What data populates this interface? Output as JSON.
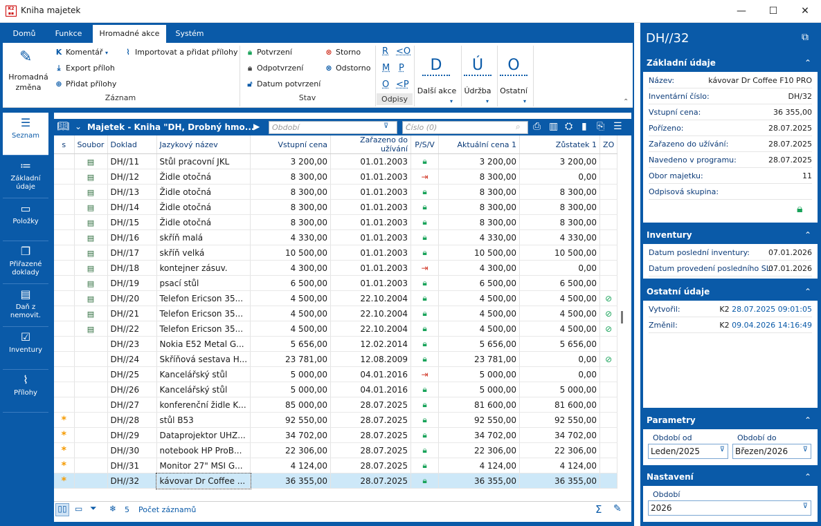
{
  "window": {
    "title": "Kniha majetek",
    "minimize": "—",
    "maximize": "☐",
    "close": "✕"
  },
  "ribbon_tabs": [
    "Domů",
    "Funkce",
    "Hromadné akce",
    "Systém"
  ],
  "ribbon": {
    "hromadna_zmena": "Hromadná změna",
    "komentar": "Komentář",
    "export_priloh": "Export příloh",
    "pridat_prilohy": "Přidat přílohy",
    "importovat": "Importovat a přidat přílohy",
    "group_zaznam": "Záznam",
    "potvrzeni": "Potvrzení",
    "odpotvrzeni": "Odpotvrzení",
    "datum_potvrzeni": "Datum potvrzení",
    "storno": "Storno",
    "odstorno": "Odstorno",
    "group_stav": "Stav",
    "odpis_r": "R",
    "odpis_lo": "<O",
    "odpis_m": "M",
    "odpis_p": "P",
    "odpis_o": "O",
    "odpis_lp": "<P",
    "group_odpisy": "Odpisy",
    "dalsi_letter": "D",
    "dalsi_akce": "Další akce",
    "udrzba_letter": "Ú",
    "udrzba": "Údržba",
    "ostatni_letter": "O",
    "ostatni": "Ostatní"
  },
  "sidebar": [
    {
      "label": "Seznam",
      "icon": "list-lines-icon"
    },
    {
      "label": "Základní údaje",
      "icon": "list-icon"
    },
    {
      "label": "Položky",
      "icon": "box-icon"
    },
    {
      "label": "Přiřazené doklady",
      "icon": "documents-icon"
    },
    {
      "label": "Daň z nemovit.",
      "icon": "calendar-icon"
    },
    {
      "label": "Inventury",
      "icon": "checklist-icon"
    },
    {
      "label": "Přílohy",
      "icon": "paperclip-icon"
    }
  ],
  "grid_toolbar": {
    "title": "Majetek - Kniha \"DH, Drobný hmo...",
    "obdobi_placeholder": "Období",
    "cislo_placeholder": "Číslo (0)"
  },
  "columns": [
    "s",
    "Soubor",
    "Doklad",
    "Jazykový název",
    "Vstupní cena",
    "Zařazeno do užívání",
    "P/S/V",
    "Aktuální cena 1",
    "Zůstatek 1",
    "ZO"
  ],
  "rows": [
    {
      "s": "",
      "file": true,
      "doklad": "DH//11",
      "nazev": "Stůl pracovní JKL",
      "vstup": "3 200,00",
      "zarazeno": "01.01.2003",
      "psv": "lock",
      "akt": "3 200,00",
      "zust": "3 200,00",
      "zo": false
    },
    {
      "s": "",
      "file": true,
      "doklad": "DH//12",
      "nazev": "Židle otočná",
      "vstup": "8 300,00",
      "zarazeno": "01.01.2003",
      "psv": "out",
      "akt": "8 300,00",
      "zust": "0,00",
      "zo": false
    },
    {
      "s": "",
      "file": true,
      "doklad": "DH//13",
      "nazev": "Židle otočná",
      "vstup": "8 300,00",
      "zarazeno": "01.01.2003",
      "psv": "lock",
      "akt": "8 300,00",
      "zust": "8 300,00",
      "zo": false
    },
    {
      "s": "",
      "file": true,
      "doklad": "DH//14",
      "nazev": "Židle otočná",
      "vstup": "8 300,00",
      "zarazeno": "01.01.2003",
      "psv": "lock",
      "akt": "8 300,00",
      "zust": "8 300,00",
      "zo": false
    },
    {
      "s": "",
      "file": true,
      "doklad": "DH//15",
      "nazev": "Židle otočná",
      "vstup": "8 300,00",
      "zarazeno": "01.01.2003",
      "psv": "lock",
      "akt": "8 300,00",
      "zust": "8 300,00",
      "zo": false
    },
    {
      "s": "",
      "file": true,
      "doklad": "DH//16",
      "nazev": "skříň malá",
      "vstup": "4 330,00",
      "zarazeno": "01.01.2003",
      "psv": "lock",
      "akt": "4 330,00",
      "zust": "4 330,00",
      "zo": false
    },
    {
      "s": "",
      "file": true,
      "doklad": "DH//17",
      "nazev": "skříň velká",
      "vstup": "10 500,00",
      "zarazeno": "01.01.2003",
      "psv": "lock",
      "akt": "10 500,00",
      "zust": "10 500,00",
      "zo": false
    },
    {
      "s": "",
      "file": true,
      "doklad": "DH//18",
      "nazev": "kontejner zásuv.",
      "vstup": "4 300,00",
      "zarazeno": "01.01.2003",
      "psv": "out",
      "akt": "4 300,00",
      "zust": "0,00",
      "zo": false
    },
    {
      "s": "",
      "file": true,
      "doklad": "DH//19",
      "nazev": "psací stůl",
      "vstup": "6 500,00",
      "zarazeno": "01.01.2003",
      "psv": "lock",
      "akt": "6 500,00",
      "zust": "6 500,00",
      "zo": false
    },
    {
      "s": "",
      "file": true,
      "doklad": "DH//20",
      "nazev": "Telefon Ericson 35...",
      "vstup": "4 500,00",
      "zarazeno": "22.10.2004",
      "psv": "lock",
      "akt": "4 500,00",
      "zust": "4 500,00",
      "zo": true
    },
    {
      "s": "",
      "file": true,
      "doklad": "DH//21",
      "nazev": "Telefon Ericson 35...",
      "vstup": "4 500,00",
      "zarazeno": "22.10.2004",
      "psv": "lock",
      "akt": "4 500,00",
      "zust": "4 500,00",
      "zo": true
    },
    {
      "s": "",
      "file": true,
      "doklad": "DH//22",
      "nazev": "Telefon Ericson 35...",
      "vstup": "4 500,00",
      "zarazeno": "22.10.2004",
      "psv": "lock",
      "akt": "4 500,00",
      "zust": "4 500,00",
      "zo": true
    },
    {
      "s": "",
      "file": false,
      "doklad": "DH//23",
      "nazev": "Nokia E52 Metal G...",
      "vstup": "5 656,00",
      "zarazeno": "12.02.2014",
      "psv": "lock",
      "akt": "5 656,00",
      "zust": "5 656,00",
      "zo": false
    },
    {
      "s": "",
      "file": false,
      "doklad": "DH//24",
      "nazev": "Skříňová sestava H...",
      "vstup": "23 781,00",
      "zarazeno": "12.08.2009",
      "psv": "lock",
      "akt": "23 781,00",
      "zust": "0,00",
      "zo": true
    },
    {
      "s": "",
      "file": false,
      "doklad": "DH//25",
      "nazev": "Kancelářský stůl",
      "vstup": "5 000,00",
      "zarazeno": "04.01.2016",
      "psv": "out",
      "akt": "5 000,00",
      "zust": "0,00",
      "zo": false
    },
    {
      "s": "",
      "file": false,
      "doklad": "DH//26",
      "nazev": "Kancelářský stůl",
      "vstup": "5 000,00",
      "zarazeno": "04.01.2016",
      "psv": "lock",
      "akt": "5 000,00",
      "zust": "5 000,00",
      "zo": false
    },
    {
      "s": "",
      "file": false,
      "doklad": "DH//27",
      "nazev": "konferenční židle K...",
      "vstup": "85 000,00",
      "zarazeno": "28.07.2025",
      "psv": "lock",
      "akt": "81 600,00",
      "zust": "81 600,00",
      "zo": false
    },
    {
      "s": "*",
      "file": false,
      "doklad": "DH//28",
      "nazev": "stůl B53",
      "vstup": "92 550,00",
      "zarazeno": "28.07.2025",
      "psv": "lock",
      "akt": "92 550,00",
      "zust": "92 550,00",
      "zo": false
    },
    {
      "s": "*",
      "file": false,
      "doklad": "DH//29",
      "nazev": "Dataprojektor UHZ...",
      "vstup": "34 702,00",
      "zarazeno": "28.07.2025",
      "psv": "lock",
      "akt": "34 702,00",
      "zust": "34 702,00",
      "zo": false
    },
    {
      "s": "*",
      "file": false,
      "doklad": "DH//30",
      "nazev": "notebook HP ProB...",
      "vstup": "22 306,00",
      "zarazeno": "28.07.2025",
      "psv": "lock",
      "akt": "22 306,00",
      "zust": "22 306,00",
      "zo": false
    },
    {
      "s": "*",
      "file": false,
      "doklad": "DH//31",
      "nazev": "Monitor 27\" MSI G...",
      "vstup": "4 124,00",
      "zarazeno": "28.07.2025",
      "psv": "lock",
      "akt": "4 124,00",
      "zust": "4 124,00",
      "zo": false
    },
    {
      "s": "*",
      "file": false,
      "doklad": "DH//32",
      "nazev": "kávovar Dr Coffee ...",
      "vstup": "36 355,00",
      "zarazeno": "28.07.2025",
      "psv": "lock",
      "akt": "36 355,00",
      "zust": "36 355,00",
      "zo": false,
      "selected": true
    }
  ],
  "footer": {
    "count": "5",
    "pocet": "Počet záznamů"
  },
  "detail": {
    "title": "DH//32",
    "zakladni": {
      "header": "Základní údaje",
      "rows": [
        {
          "k": "Název:",
          "v": "kávovar Dr Coffee F10 PRO"
        },
        {
          "k": "Inventární číslo:",
          "v": "DH/32"
        },
        {
          "k": "Vstupní cena:",
          "v": "36 355,00"
        },
        {
          "k": "Pořízeno:",
          "v": "28.07.2025"
        },
        {
          "k": "Zařazeno do užívání:",
          "v": "28.07.2025"
        },
        {
          "k": "Navedeno v programu:",
          "v": "28.07.2025"
        },
        {
          "k": "Obor majetku:",
          "v": "11"
        },
        {
          "k": "Odpisová skupina:",
          "v": ""
        }
      ]
    },
    "inventury": {
      "header": "Inventury",
      "rows": [
        {
          "k": "Datum poslední inventury:",
          "v": "07.01.2026"
        },
        {
          "k": "Datum provedení posledního SL:",
          "v": "07.01.2026"
        }
      ]
    },
    "ostatni": {
      "header": "Ostatní údaje",
      "rows": [
        {
          "k": "Vytvořil:",
          "u": "K2",
          "v": "28.07.2025 09:01:05"
        },
        {
          "k": "Změnil:",
          "u": "K2",
          "v": "09.04.2026 14:16:49"
        }
      ]
    },
    "parametry": {
      "header": "Parametry",
      "od_label": "Období od",
      "od_value": "Leden/2025",
      "do_label": "Období do",
      "do_value": "Březen/2026"
    },
    "nastaveni": {
      "header": "Nastavení",
      "obdobi_label": "Období",
      "obdobi_value": "2026"
    }
  },
  "colors": {
    "brand": "#0a5aa8",
    "lock": "#19a35a",
    "out": "#d23a2a",
    "star": "#f59a00",
    "selected": "#cde8f8"
  }
}
